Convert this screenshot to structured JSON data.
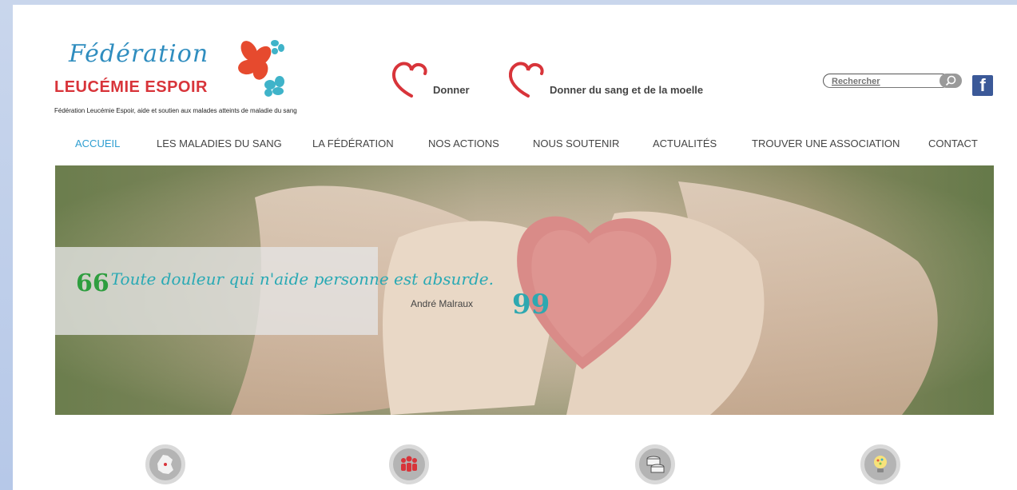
{
  "logo": {
    "script": "Fédération",
    "main": "LEUCÉMIE ESPOIR",
    "tagline": "Fédération Leucémie Espoir, aide et soutien aux malades atteints de maladie du sang"
  },
  "header": {
    "donate_label": "Donner",
    "blood_label": "Donner du sang et de la moelle",
    "search_placeholder": "Rechercher",
    "facebook_label": "f"
  },
  "nav": {
    "items": [
      {
        "label": "ACCUEIL",
        "active": true
      },
      {
        "label": "LES MALADIES DU SANG"
      },
      {
        "label": "LA FÉDÉRATION"
      },
      {
        "label": "NOS ACTIONS"
      },
      {
        "label": "NOUS SOUTENIR"
      },
      {
        "label": "ACTUALITÉS"
      },
      {
        "label": "TROUVER UNE ASSOCIATION"
      },
      {
        "label": "CONTACT"
      }
    ]
  },
  "hero": {
    "quote_open": "66",
    "quote": "Toute douleur qui n'aide personne est absurde.",
    "author": "André Malraux",
    "quote_close": "99"
  },
  "icons": [
    {
      "name": "france-map-icon"
    },
    {
      "name": "people-group-icon"
    },
    {
      "name": "coins-stack-icon"
    },
    {
      "name": "lightbulb-icon"
    }
  ],
  "colors": {
    "accent_blue": "#2e9ed1",
    "brand_red": "#d8343a",
    "quote_teal": "#29a9b4",
    "facebook": "#3b5998"
  }
}
